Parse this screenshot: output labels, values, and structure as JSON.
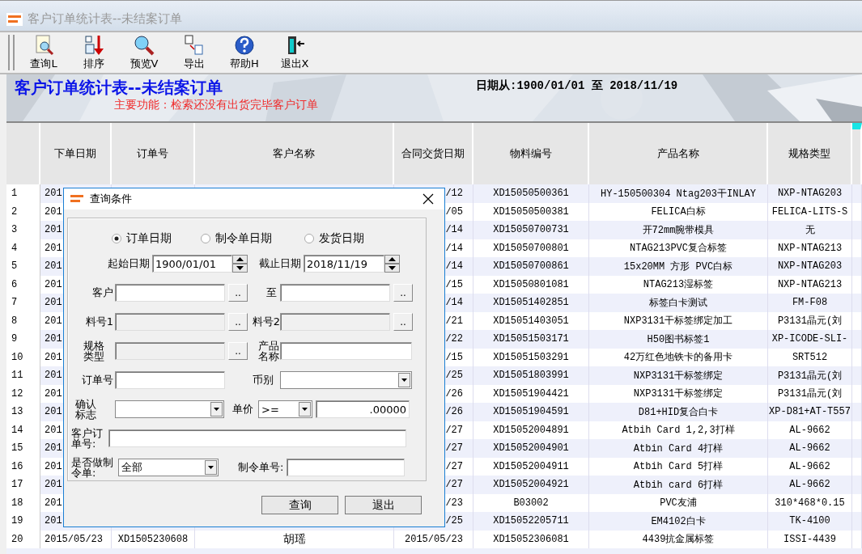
{
  "window": {
    "title": "客户订单统计表--未结案订单"
  },
  "toolbar": [
    {
      "label": "查询L"
    },
    {
      "label": "排序"
    },
    {
      "label": "预览V"
    },
    {
      "label": "导出"
    },
    {
      "label": "帮助H"
    },
    {
      "label": "退出X"
    }
  ],
  "banner": {
    "title": "客户订单统计表--未结案订单",
    "subtitle": "主要功能：检索还没有出货完毕客户订单",
    "date_range": "日期从:1900/01/01 至 2018/11/19"
  },
  "table": {
    "columns": [
      "下单日期",
      "订单号",
      "客户名称",
      "合同交货日期",
      "物料编号",
      "产品名称",
      "规格类型"
    ],
    "rows": [
      {
        "number": "1",
        "order_date": "201",
        "contract_date": "/12",
        "material_no": "XD15050500361",
        "product_name": "HY-150500304  Ntag203干INLAY",
        "spec": "NXP-NTAG203"
      },
      {
        "number": "2",
        "order_date": "201",
        "contract_date": "/05",
        "material_no": "XD15050500381",
        "product_name": "FELICA白标",
        "spec": "FELICA-LITS-S"
      },
      {
        "number": "3",
        "order_date": "201",
        "contract_date": "/14",
        "material_no": "XD15050700731",
        "product_name": "开72mm腕带模具",
        "spec": "无"
      },
      {
        "number": "4",
        "order_date": "201",
        "contract_date": "/14",
        "material_no": "XD15050700801",
        "product_name": "NTAG213PVC复合标签",
        "spec": "NXP-NTAG213"
      },
      {
        "number": "5",
        "order_date": "201",
        "contract_date": "/14",
        "material_no": "XD15050700861",
        "product_name": "15x20MM 方形 PVC白标",
        "spec": "NXP-NTAG203"
      },
      {
        "number": "6",
        "order_date": "201",
        "contract_date": "/15",
        "material_no": "XD15050801081",
        "product_name": "NTAG213湿标签",
        "spec": "NXP-NTAG213"
      },
      {
        "number": "7",
        "order_date": "201",
        "contract_date": "/14",
        "material_no": "XD15051402851",
        "product_name": "标签白卡测试",
        "spec": "FM-F08"
      },
      {
        "number": "8",
        "order_date": "201",
        "contract_date": "/21",
        "material_no": "XD15051403051",
        "product_name": "NXP3131干标签绑定加工",
        "spec": "P3131晶元(刘"
      },
      {
        "number": "9",
        "order_date": "201",
        "contract_date": "/22",
        "material_no": "XD15051503171",
        "product_name": "H50图书标签1",
        "spec": "XP-ICODE-SLI-"
      },
      {
        "number": "10",
        "order_date": "201",
        "contract_date": "/15",
        "material_no": "XD15051503291",
        "product_name": "42万红色地铁卡的备用卡",
        "spec": "SRT512"
      },
      {
        "number": "11",
        "order_date": "201",
        "contract_date": "/25",
        "material_no": "XD15051803991",
        "product_name": "NXP3131干标签绑定",
        "spec": "P3131晶元(刘"
      },
      {
        "number": "12",
        "order_date": "201",
        "contract_date": "/26",
        "material_no": "XD15051904421",
        "product_name": "NXP3131干标签绑定",
        "spec": "P3131晶元(刘"
      },
      {
        "number": "13",
        "order_date": "201",
        "contract_date": "/26",
        "material_no": "XD15051904591",
        "product_name": "D81+HID复合白卡",
        "spec": "XP-D81+AT-T557"
      },
      {
        "number": "14",
        "order_date": "201",
        "contract_date": "/27",
        "material_no": "XD15052004891",
        "product_name": "Atbih Card 1,2,3打样",
        "spec": "AL-9662"
      },
      {
        "number": "15",
        "order_date": "201",
        "contract_date": "/27",
        "material_no": "XD15052004901",
        "product_name": "Atbin Card 4打样",
        "spec": "AL-9662"
      },
      {
        "number": "16",
        "order_date": "201",
        "contract_date": "/27",
        "material_no": "XD15052004911",
        "product_name": "Atbih Card 5打样",
        "spec": "AL-9662"
      },
      {
        "number": "17",
        "order_date": "201",
        "contract_date": "/27",
        "material_no": "XD15052004921",
        "product_name": "Atbih card 6打样",
        "spec": "AL-9662"
      },
      {
        "number": "18",
        "order_date": "201",
        "contract_date": "/23",
        "material_no": "B03002",
        "product_name": "PVC友浦",
        "spec": "310*468*0.15"
      },
      {
        "number": "19",
        "order_date": "201",
        "contract_date": "/25",
        "material_no": "XD15052205711",
        "product_name": "EM4102白卡",
        "spec": "TK-4100"
      },
      {
        "number": "20",
        "order_date": "2015/05/23",
        "order_no": "XD1505230608",
        "customer": "胡瑶",
        "contract_date": "2015/05/23",
        "material_no": "XD15052306081",
        "product_name": "4439抗金属标签",
        "spec": "ISSI-4439"
      }
    ]
  },
  "dialog": {
    "title": "查询条件",
    "date_type": [
      {
        "label": "订单日期",
        "selected": true
      },
      {
        "label": "制令单日期",
        "selected": false
      },
      {
        "label": "发货日期",
        "selected": false
      }
    ],
    "start_date": {
      "label": "起始日期",
      "value": "1900/01/01"
    },
    "end_date": {
      "label": "截止日期",
      "value": "2018/11/19"
    },
    "customer_from": {
      "label": "客户",
      "disabled": false,
      "button": ".."
    },
    "customer_to": {
      "label": "至",
      "disabled": false,
      "button": ".."
    },
    "material_1": {
      "label": "料号1",
      "disabled": true,
      "button": ".."
    },
    "material_2": {
      "label": "料号2",
      "disabled": true,
      "button": ".."
    },
    "spec_type": {
      "label": "规格类型",
      "disabled": true,
      "button": ".."
    },
    "product_name": {
      "label": "产品名称",
      "disabled": false
    },
    "order_no": {
      "label": "订单号",
      "disabled": false
    },
    "currency": {
      "label": "币别"
    },
    "confirm_flag": {
      "label": "确认标志"
    },
    "unit_price": {
      "label": "单价",
      "operator": ">=",
      "value": ".00000"
    },
    "customer_order_no": {
      "label": "客户订单号:",
      "disabled": false
    },
    "work_order_made": {
      "label": "是否做制令单:",
      "value": "全部"
    },
    "work_order_no": {
      "label": "制令单号:",
      "disabled": false
    },
    "buttons": [
      "查询",
      "退出"
    ]
  }
}
